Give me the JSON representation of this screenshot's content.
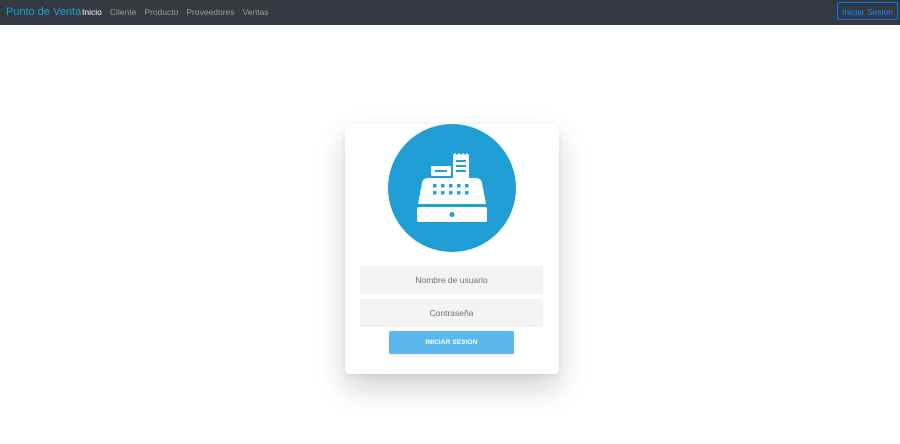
{
  "navbar": {
    "brand": "Punto de Venta",
    "links": [
      {
        "label": "Inicio",
        "active": true
      },
      {
        "label": "Cliente",
        "active": false
      },
      {
        "label": "Producto",
        "active": false
      },
      {
        "label": "Proveedores",
        "active": false
      },
      {
        "label": "Ventas",
        "active": false
      }
    ],
    "login_button": "Iniciar Sesion"
  },
  "login_card": {
    "icon": "cash-register-icon",
    "username_placeholder": "Nombre de usuario",
    "password_placeholder": "Contraseña",
    "submit_label": "INICIAR SESION"
  },
  "colors": {
    "navbar_bg": "#343a40",
    "brand": "#17a2d8",
    "outline_button": "#007bff",
    "avatar_bg": "#1f9fd5",
    "submit_bg": "#5ab8ea",
    "field_bg": "#f3f3f3"
  }
}
